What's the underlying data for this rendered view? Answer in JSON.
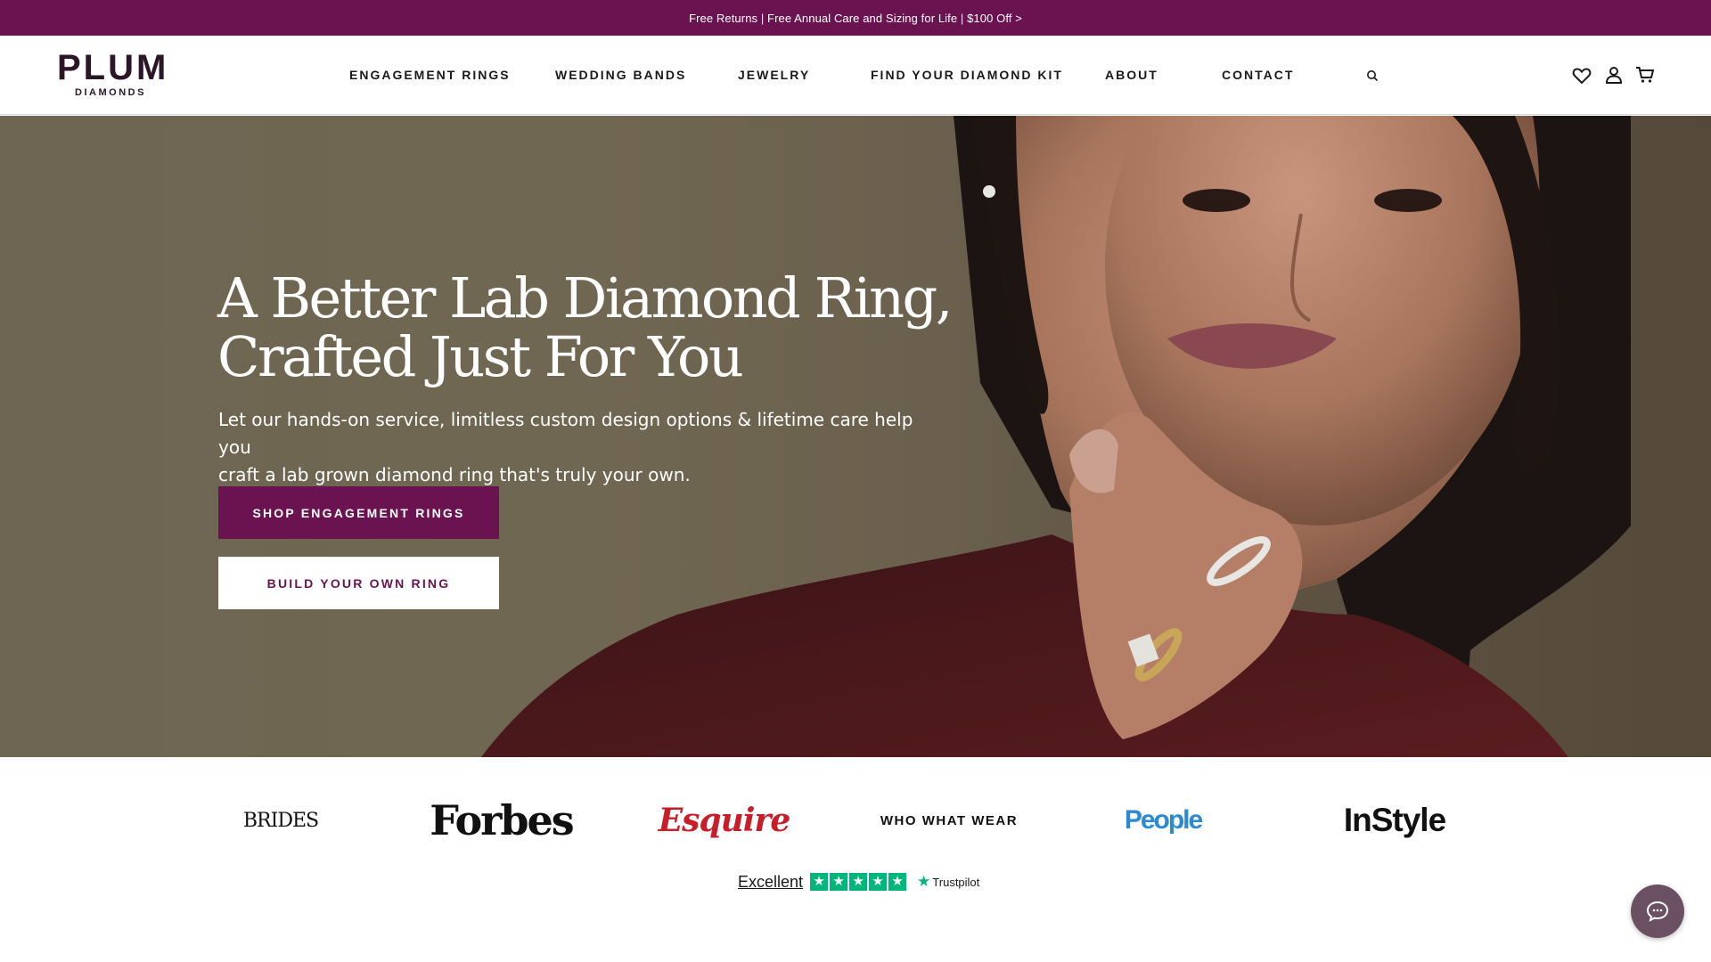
{
  "announcement": {
    "text": "Free Returns | Free Annual Care and Sizing for Life | $100 Off >"
  },
  "header": {
    "logo": {
      "main": "PLUM",
      "sub": "DIAMONDS"
    },
    "nav": [
      {
        "label": "ENGAGEMENT RINGS"
      },
      {
        "label": "WEDDING BANDS"
      },
      {
        "label": "JEWELRY"
      },
      {
        "label": "FIND YOUR DIAMOND KIT"
      },
      {
        "label": "ABOUT"
      },
      {
        "label": "CONTACT"
      }
    ],
    "icons": [
      "search-icon",
      "heart-icon",
      "account-icon",
      "cart-icon"
    ]
  },
  "hero": {
    "title_line1": "A Better Lab Diamond Ring,",
    "title_line2": "Crafted Just For You",
    "subtitle_line1": "Let our hands-on service, limitless custom design options & lifetime care help you",
    "subtitle_line2": "craft a lab grown diamond ring that's truly your own.",
    "primary_button": "SHOP ENGAGEMENT RINGS",
    "secondary_button": "BUILD YOUR OWN RING"
  },
  "press": {
    "logos": [
      "BRIDES",
      "Forbes",
      "Esquire",
      "WHO WHAT WEAR",
      "People",
      "InStyle"
    ]
  },
  "trustpilot": {
    "rating_word": "Excellent",
    "stars": 5,
    "brand": "Trustpilot"
  },
  "colors": {
    "brand": "#6b1350",
    "trustpilot_green": "#00b67a"
  }
}
